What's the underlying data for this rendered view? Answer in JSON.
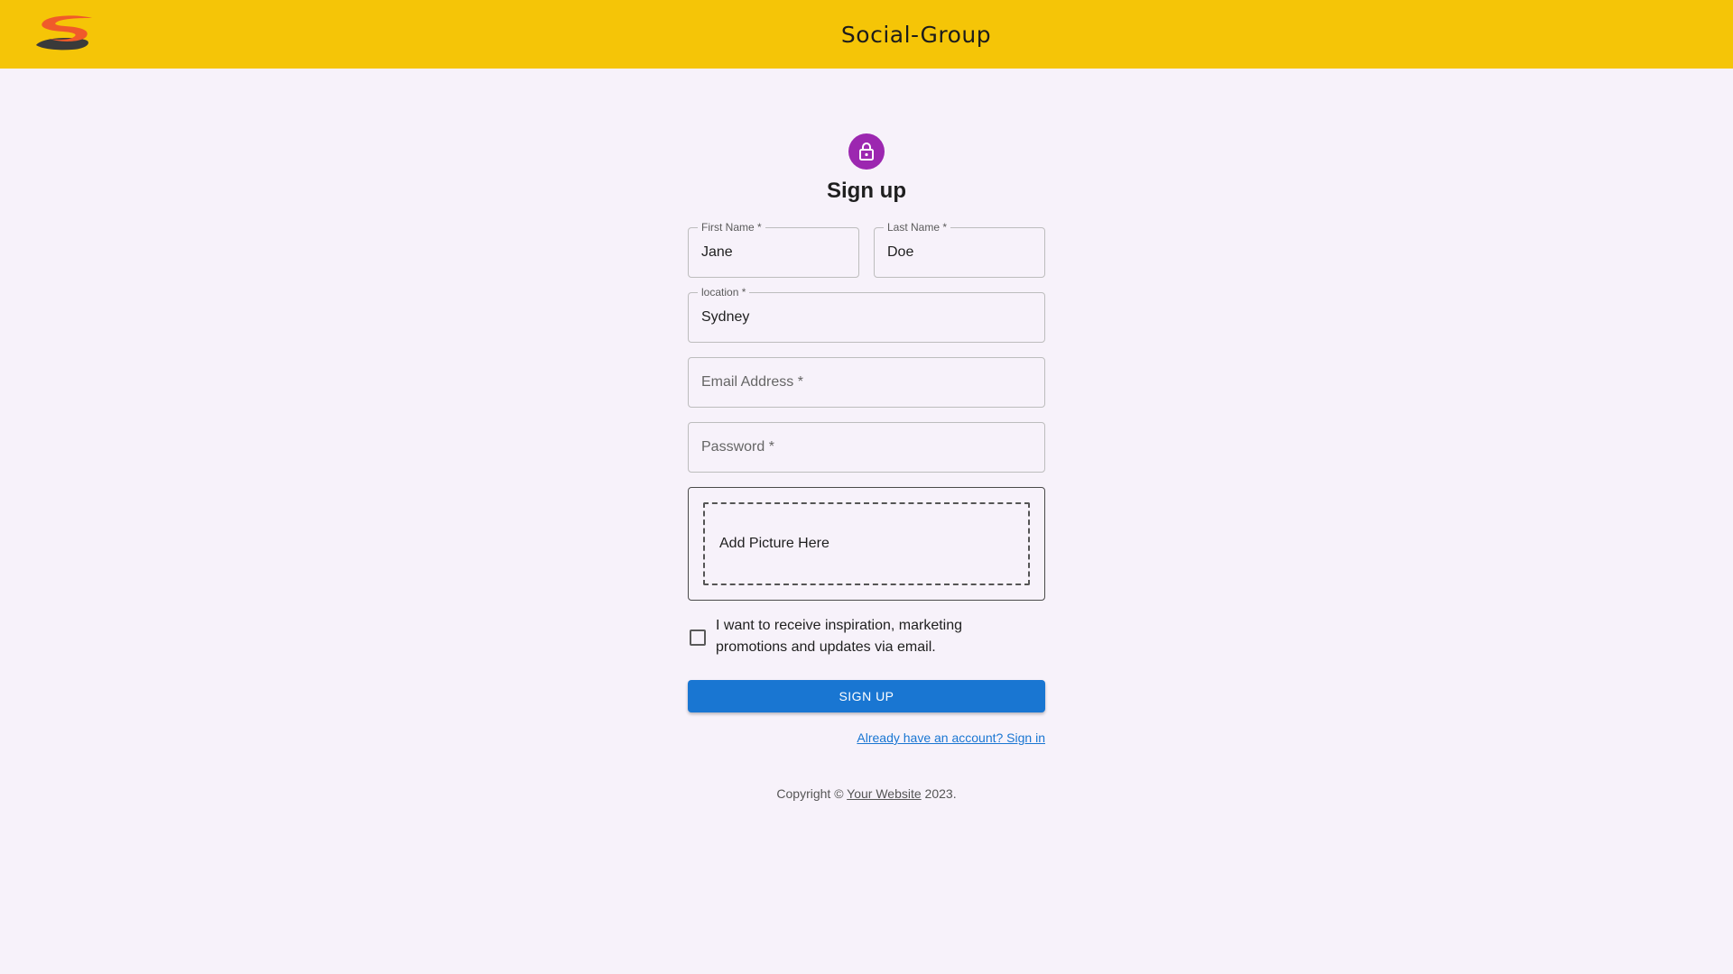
{
  "appbar": {
    "title": "Social-Group",
    "logo_icon": "s-swoosh-logo",
    "background_color": "#f5c507"
  },
  "form": {
    "avatar_icon": "lock-icon",
    "avatar_color": "#9c27b0",
    "heading": "Sign up",
    "first_name": {
      "label": "First Name *",
      "value": "Jane"
    },
    "last_name": {
      "label": "Last Name *",
      "value": "Doe"
    },
    "location": {
      "label": "location *",
      "value": "Sydney"
    },
    "email": {
      "placeholder": "Email Address *",
      "value": ""
    },
    "password": {
      "placeholder": "Password *",
      "value": ""
    },
    "picture_dropzone": "Add Picture Here",
    "marketing_checkbox": {
      "checked": false,
      "label": "I want to receive inspiration, marketing promotions and updates via email."
    },
    "submit_label": "SIGN UP",
    "submit_color": "#1976d2",
    "signin_link": "Already have an account? Sign in"
  },
  "footer": {
    "prefix": "Copyright © ",
    "site_link": "Your Website",
    "suffix": " 2023."
  }
}
